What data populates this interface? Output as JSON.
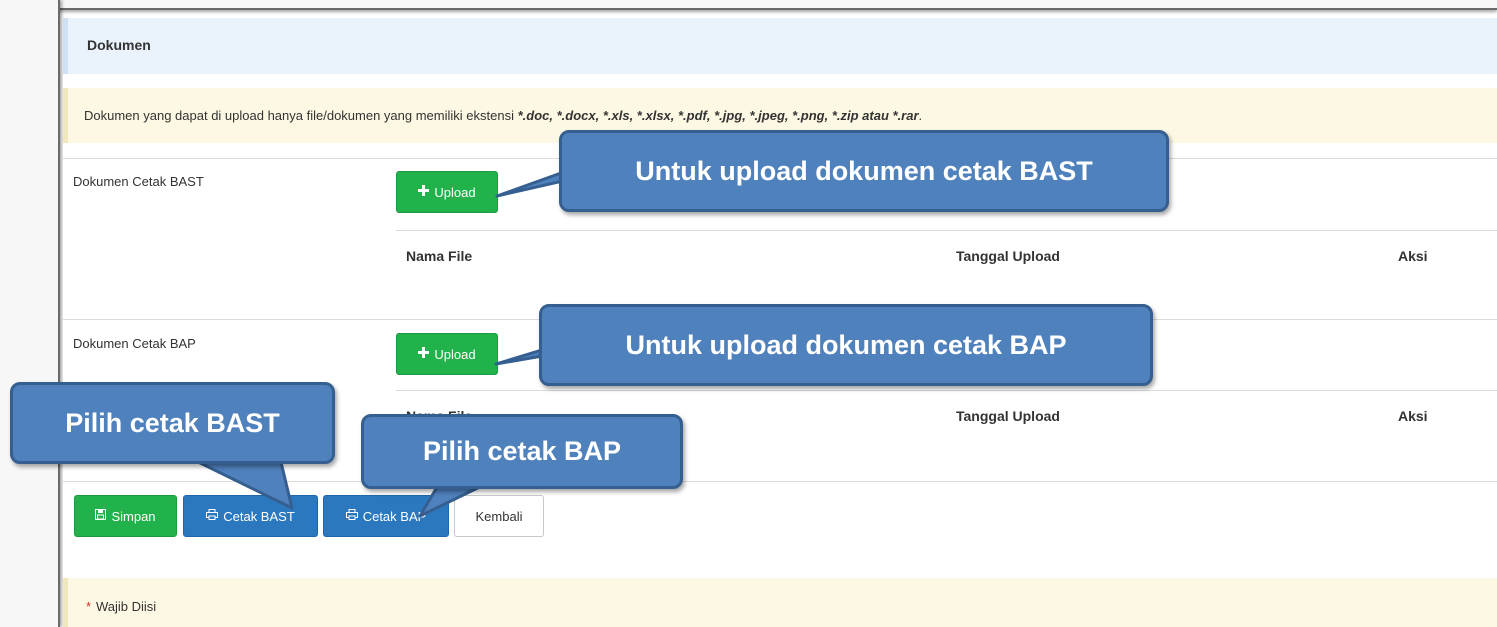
{
  "panel": {
    "title": "Dokumen"
  },
  "notice": {
    "prefix": "Dokumen yang dapat di upload hanya file/dokumen yang memiliki ekstensi ",
    "extensions": "*.doc, *.docx, *.xls, *.xlsx, *.pdf, *.jpg, *.jpeg, *.png, *.zip atau *.rar",
    "suffix": "."
  },
  "sections": [
    {
      "label": "Dokumen Cetak BAST",
      "upload_label": "Upload",
      "columns": [
        "Nama File",
        "Tanggal Upload",
        "Aksi"
      ]
    },
    {
      "label": "Dokumen Cetak BAP",
      "upload_label": "Upload",
      "columns": [
        "Nama File",
        "Tanggal Upload",
        "Aksi"
      ]
    }
  ],
  "actions": {
    "simpan": "Simpan",
    "cetak_bast": "Cetak BAST",
    "cetak_bap": "Cetak BAP",
    "kembali": "Kembali"
  },
  "required": {
    "star": "*",
    "label": "Wajib Diisi"
  },
  "callouts": {
    "upload_bast": "Untuk upload dokumen cetak BAST",
    "upload_bap": "Untuk upload dokumen cetak BAP",
    "pilih_bast": "Pilih cetak BAST",
    "pilih_bap": "Pilih cetak BAP"
  },
  "icons": {
    "upload": "plus-icon",
    "simpan": "save-icon",
    "cetak": "print-icon"
  },
  "colors": {
    "success": "#22b24c",
    "primary": "#2b78bf",
    "callout": "#4f81bd",
    "callout_border": "#365f91",
    "required_star": "#d9302c"
  }
}
